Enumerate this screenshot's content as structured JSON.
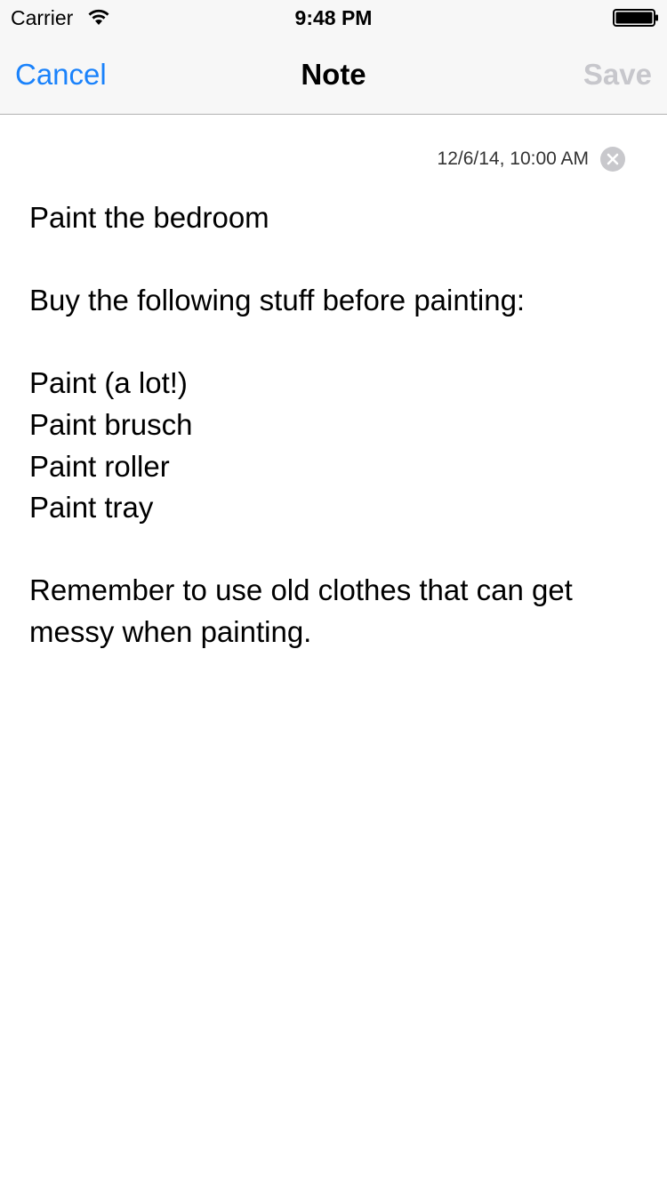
{
  "status_bar": {
    "carrier": "Carrier",
    "time": "9:48 PM",
    "wifi_icon": "wifi-icon",
    "battery_icon": "battery-full-icon"
  },
  "nav": {
    "cancel_label": "Cancel",
    "title": "Note",
    "save_label": "Save",
    "accent_color": "#1a82fb",
    "disabled_color": "#c7c7cc"
  },
  "reminder": {
    "date": "12/6/14, 10:00 AM",
    "clear_icon": "clear-circle-icon"
  },
  "note": {
    "lines": [
      "Paint the bedroom",
      "",
      "Buy the following stuff before painting:",
      "",
      "Paint (a lot!)",
      "Paint brusch",
      "Paint roller",
      "Paint tray",
      "",
      "Remember to use old clothes that can get",
      "messy when painting."
    ]
  }
}
